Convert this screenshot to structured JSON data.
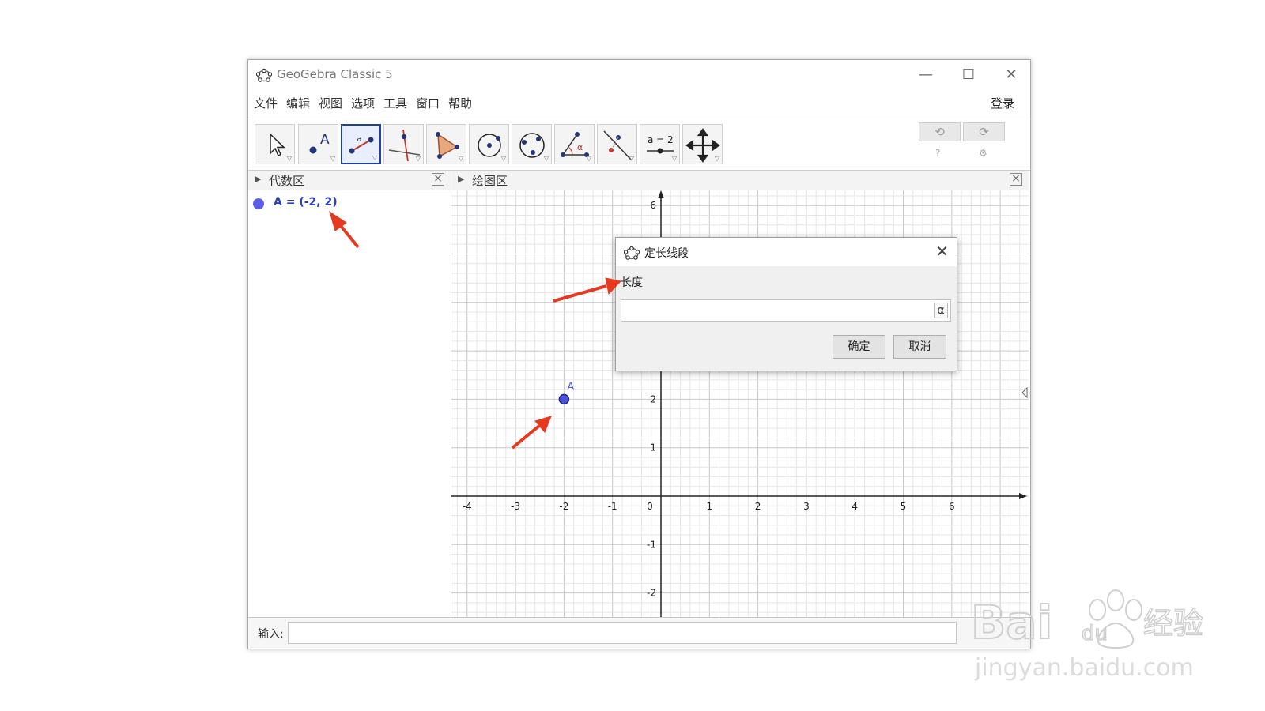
{
  "window": {
    "title": "GeoGebra Classic 5",
    "controls": {
      "minimize": "—",
      "maximize": "☐",
      "close": "✕"
    }
  },
  "menu": {
    "items": [
      "文件",
      "编辑",
      "视图",
      "选项",
      "工具",
      "窗口",
      "帮助"
    ],
    "login": "登录"
  },
  "toolbar": {
    "tools": [
      {
        "name": "move-tool",
        "icon": "arrow-cursor-icon"
      },
      {
        "name": "point-tool",
        "icon": "point-icon"
      },
      {
        "name": "segment-fixed-length-tool",
        "icon": "segment-icon",
        "selected": true
      },
      {
        "name": "perpendicular-line-tool",
        "icon": "perpendicular-icon"
      },
      {
        "name": "polygon-tool",
        "icon": "polygon-icon"
      },
      {
        "name": "circle-tool",
        "icon": "circle-center-icon"
      },
      {
        "name": "ellipse-tool",
        "icon": "ellipse-icon"
      },
      {
        "name": "angle-tool",
        "icon": "angle-icon"
      },
      {
        "name": "reflect-tool",
        "icon": "reflect-icon"
      },
      {
        "name": "slider-tool",
        "icon": "slider-icon",
        "label": "a = 2"
      },
      {
        "name": "move-graphics-tool",
        "icon": "move-view-icon"
      }
    ],
    "undo": "⟲",
    "redo": "⟳",
    "help": "?",
    "settings": "⚙"
  },
  "algebra": {
    "title": "代数区",
    "objects": [
      {
        "text": "A = (-2, 2)",
        "color": "#5b5ee6"
      }
    ]
  },
  "graphics": {
    "title": "绘图区",
    "x_ticks": [
      "-4",
      "-3",
      "-2",
      "-1",
      "0",
      "1",
      "2",
      "3",
      "4",
      "5",
      "6"
    ],
    "y_ticks": [
      "6",
      "2",
      "1",
      "-1",
      "-2"
    ],
    "point": {
      "label": "A",
      "x": -2,
      "y": 2,
      "color": "#4a50d8"
    },
    "xlim": [
      -4.4,
      7
    ],
    "ylim": [
      -2.3,
      6.3
    ]
  },
  "input_bar": {
    "label": "输入:"
  },
  "dialog": {
    "title": "定长线段",
    "label": "长度",
    "input_value": "",
    "alpha_button": "α",
    "ok": "确定",
    "cancel": "取消"
  },
  "watermark": {
    "brand": "Bai du 经验",
    "url": "jingyan.baidu.com"
  },
  "colors": {
    "selected_tool": "#1f3f9f",
    "arrow": "#e53a1f",
    "grid_major": "#c8c8c8",
    "grid_minor": "#e6e6e6"
  }
}
